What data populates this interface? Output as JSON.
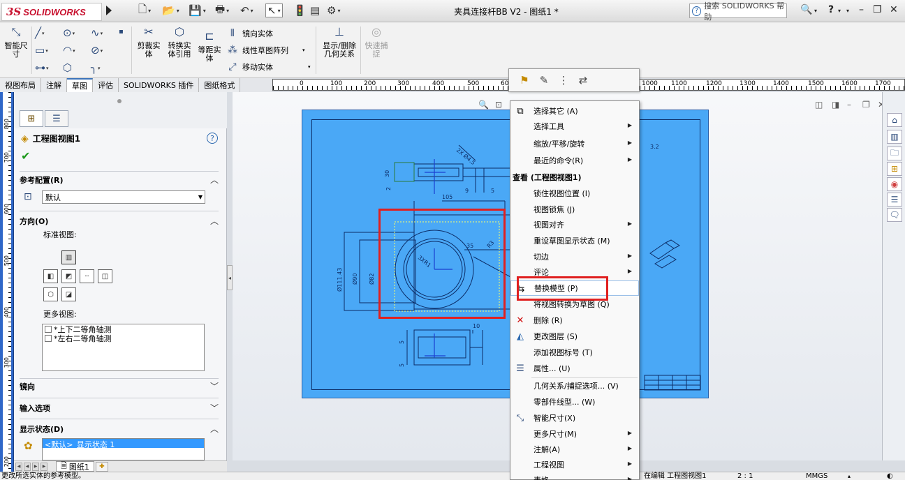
{
  "app": {
    "brand": "SOLIDWORKS",
    "brand_prefix": "3S",
    "window_title": "夹具连接杆BB V2 - 图纸1 *",
    "help_search_placeholder": "搜索 SOLIDWORKS 帮助"
  },
  "ribbon": {
    "smart_dimension": "智能尺寸",
    "trim_entities": "剪裁实体",
    "convert_entities": "转换实体引用",
    "offset_entities": "等距实体",
    "mirror_entities": "镜向实体",
    "linear_pattern": "线性草图阵列",
    "move_entities": "移动实体",
    "display_relations": "显示/删除几何关系",
    "quick_snaps": "快速捕捉"
  },
  "tabs": [
    "视图布局",
    "注解",
    "草图",
    "评估",
    "SOLIDWORKS 插件",
    "图纸格式"
  ],
  "active_tab": "草图",
  "ruler_h": [
    "0",
    "100",
    "200",
    "300",
    "400",
    "500",
    "600",
    "1000",
    "1100",
    "1200",
    "1300",
    "1400",
    "1500",
    "1600",
    "1700"
  ],
  "ruler_v": [
    "800",
    "700",
    "600",
    "500",
    "400",
    "300",
    "200"
  ],
  "property_manager": {
    "title": "工程图视图1",
    "help": "?",
    "ok": "✔",
    "ref_config_label": "参考配置(R)",
    "ref_config_value": "默认",
    "orientation_label": "方向(O)",
    "standard_views_label": "标准视图:",
    "more_views_label": "更多视图:",
    "more_views": [
      "*上下二等角轴测",
      "*左右二等角轴测"
    ],
    "mirror_label": "镜向",
    "import_options_label": "输入选项",
    "display_state_label": "显示状态(D)",
    "display_state_value": "<默认>_显示状态 1"
  },
  "sheet_tab": "图纸1",
  "status": {
    "left": "更改所选实体的参考模型。",
    "editing": "在编辑 工程图视图1",
    "scale": "2 : 1",
    "units": "MMGS"
  },
  "drawing": {
    "dims": [
      "2X Ø4.5",
      "30",
      "2",
      "9",
      "5",
      "3.2",
      "105",
      "35",
      "R3",
      "Ø111.43",
      "Ø90",
      "Ø82",
      "3XR1",
      "10",
      "5",
      "5"
    ]
  },
  "context_menu": {
    "items": [
      {
        "label": "选择其它 (A)",
        "icon": "select-other-icon",
        "sub": false
      },
      {
        "label": "选择工具",
        "icon": "",
        "sub": true
      },
      {
        "label": "缩放/平移/旋转",
        "icon": "",
        "sub": true
      },
      {
        "label": "最近的命令(R)",
        "icon": "",
        "sub": true
      },
      {
        "label": "查看 (工程图视图1)",
        "icon": "",
        "sub": false,
        "header": true
      },
      {
        "label": "锁住视图位置 (I)",
        "icon": "",
        "sub": false
      },
      {
        "label": "视图锁焦 (J)",
        "icon": "",
        "sub": false
      },
      {
        "label": "视图对齐",
        "icon": "",
        "sub": true
      },
      {
        "label": "重设草图显示状态 (M)",
        "icon": "",
        "sub": false
      },
      {
        "label": "切边",
        "icon": "",
        "sub": true
      },
      {
        "label": "评论",
        "icon": "",
        "sub": true
      },
      {
        "label": "替换模型 (P)",
        "icon": "replace-model-icon",
        "sub": false,
        "highlight": true
      },
      {
        "label": "将视图转换为草图 (Q)",
        "icon": "",
        "sub": false
      },
      {
        "label": "删除 (R)",
        "icon": "delete-icon",
        "sub": false
      },
      {
        "label": "更改图层 (S)",
        "icon": "layer-icon",
        "sub": false
      },
      {
        "label": "添加视图标号 (T)",
        "icon": "",
        "sub": false
      },
      {
        "label": "属性... (U)",
        "icon": "properties-icon",
        "sub": false
      },
      {
        "label": "几何关系/捕捉选项... (V)",
        "icon": "",
        "sub": false
      },
      {
        "label": "零部件线型... (W)",
        "icon": "",
        "sub": false
      },
      {
        "label": "智能尺寸(X)",
        "icon": "smart-dimension-icon",
        "sub": false
      },
      {
        "label": "更多尺寸(M)",
        "icon": "",
        "sub": true
      },
      {
        "label": "注解(A)",
        "icon": "",
        "sub": true
      },
      {
        "label": "工程视图",
        "icon": "",
        "sub": true
      },
      {
        "label": "表格",
        "icon": "",
        "sub": true
      }
    ]
  },
  "colors": {
    "sheet": "#4aa8f6",
    "highlight_box": "#e02020",
    "selection": "#3399ff"
  }
}
